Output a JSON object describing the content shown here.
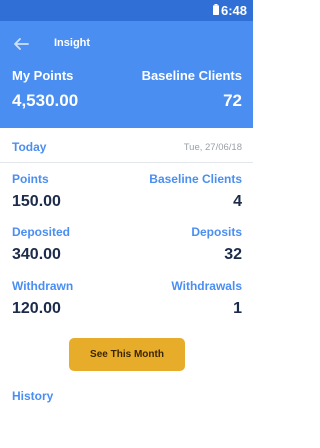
{
  "status_bar": {
    "time": "6:48",
    "battery_icon": "battery-icon"
  },
  "app_bar": {
    "title": "Insight",
    "back_icon": "arrow-left-icon",
    "my_points_label": "My Points",
    "my_points_value": "4,530.00",
    "baseline_clients_label": "Baseline Clients",
    "baseline_clients_value": "72"
  },
  "today": {
    "label": "Today",
    "date": "Tue, 27/06/18"
  },
  "stats": {
    "points_label": "Points",
    "points_value": "150.00",
    "baseline_clients_label": "Baseline Clients",
    "baseline_clients_value": "4",
    "deposited_label": "Deposited",
    "deposited_value": "340.00",
    "deposits_label": "Deposits",
    "deposits_value": "32",
    "withdrawn_label": "Withdrawn",
    "withdrawn_value": "120.00",
    "withdrawals_label": "Withdrawals",
    "withdrawals_value": "1"
  },
  "actions": {
    "see_month_label": "See This Month"
  },
  "history": {
    "label": "History"
  },
  "colors": {
    "status_bar": "#2f6fd6",
    "app_bar": "#4a8ef2",
    "accent_text": "#4a8ef2",
    "value_text": "#1c2b4a",
    "button": "#e8ac2b"
  }
}
